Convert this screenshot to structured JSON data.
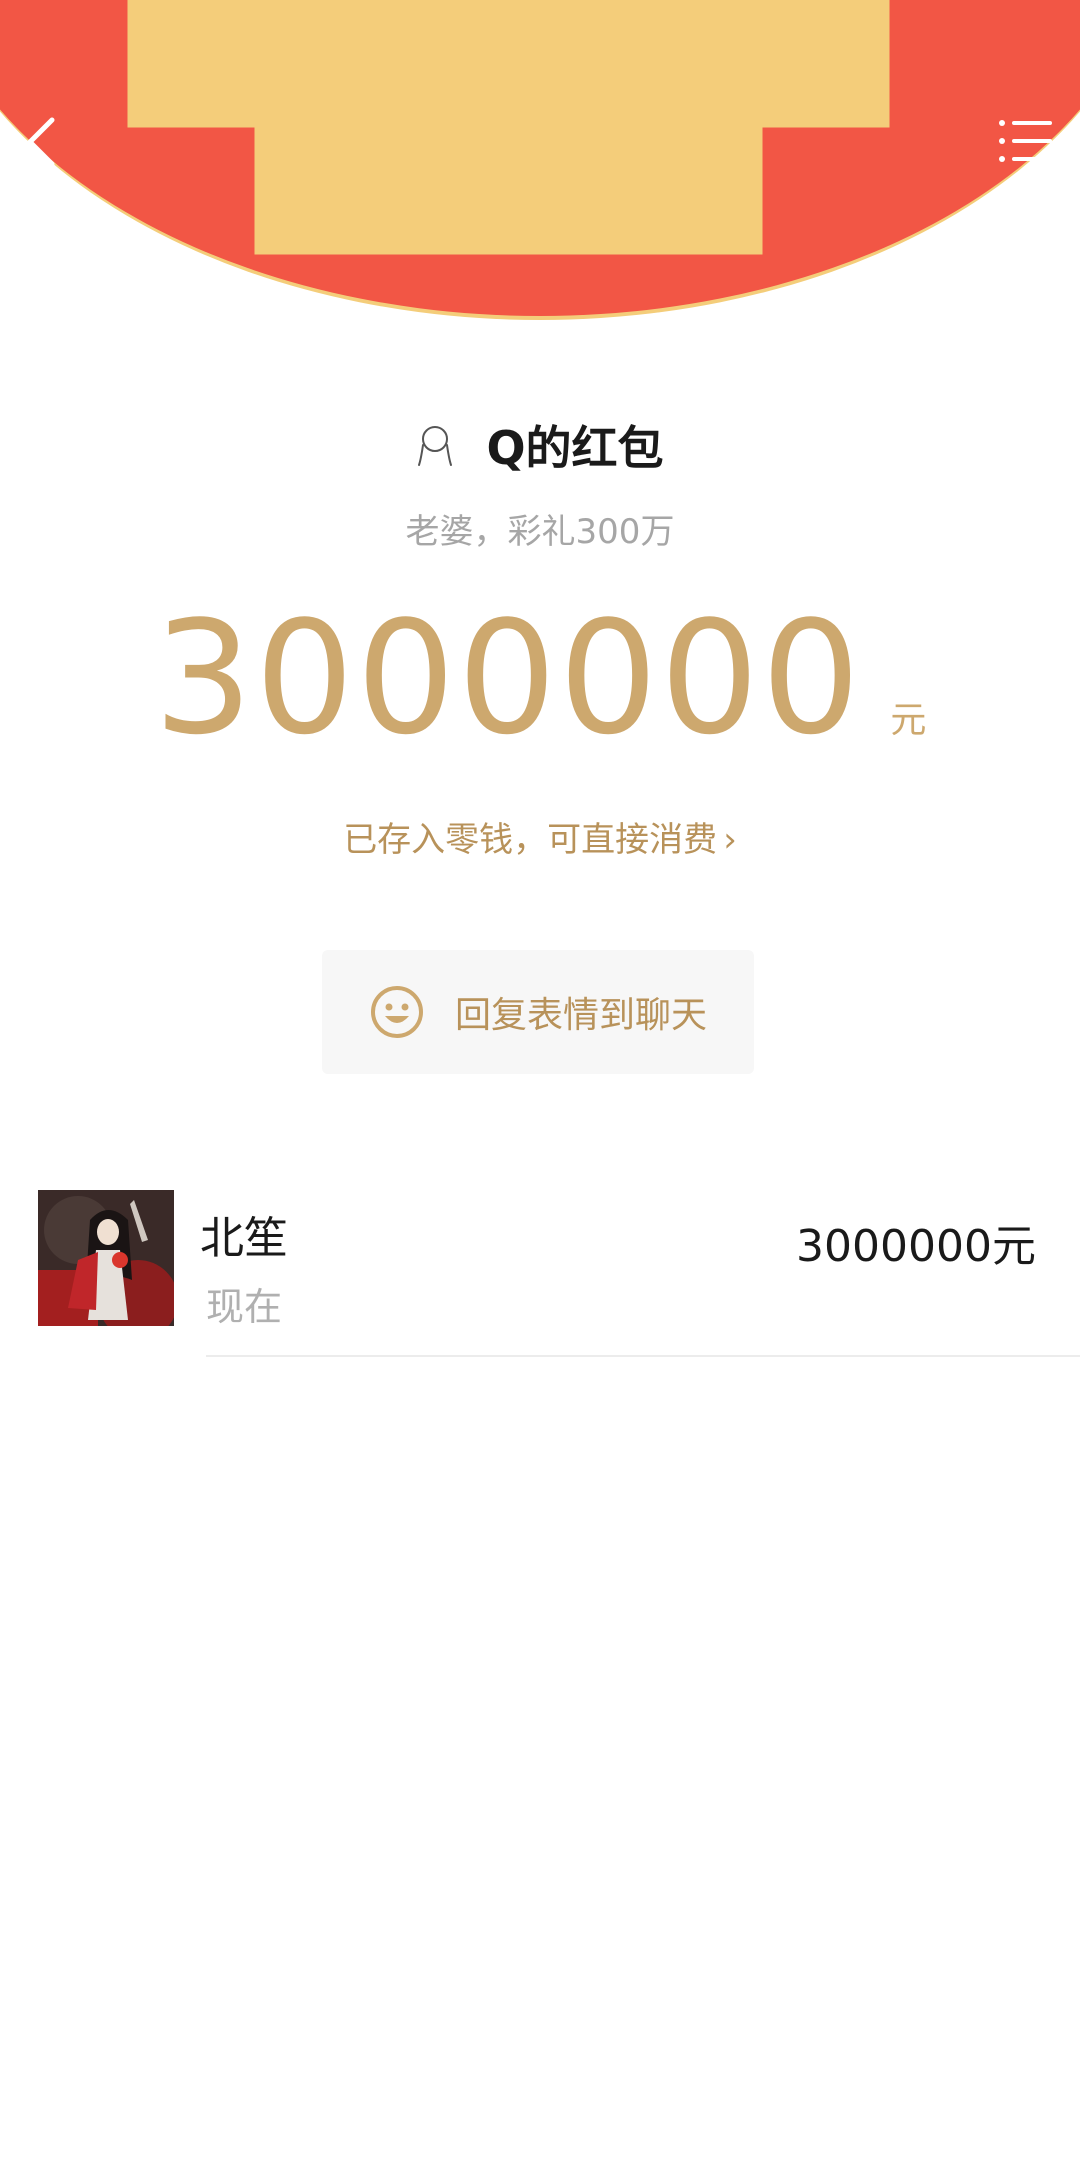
{
  "header": {
    "back_icon": "chevron-left-icon",
    "menu_icon": "list-menu-icon",
    "background_color": "#f25645",
    "edge_color": "#f4cd7a"
  },
  "packet": {
    "sender_title": "Q的红包",
    "blessing": "老婆，彩礼300万",
    "amount": "3000000",
    "amount_unit": "元",
    "deposit_text": "已存入零钱，可直接消费",
    "deposit_chevron": "›",
    "accent_color": "#cda86e"
  },
  "reply": {
    "label": "回复表情到聊天",
    "icon": "smile-icon"
  },
  "receivers": [
    {
      "name": "北笙",
      "time": "现在",
      "amount": "3000000元",
      "avatar_icon": "avatar-illustration"
    }
  ]
}
